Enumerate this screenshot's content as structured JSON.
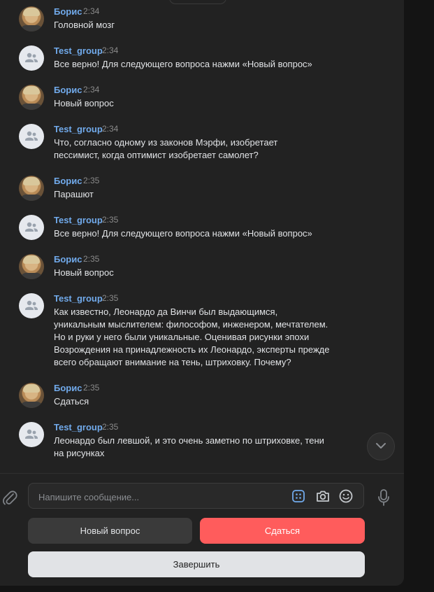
{
  "messages": [
    {
      "author": "Борис",
      "time": "2:34",
      "text": "Головной мозг",
      "avatar": "boris"
    },
    {
      "author": "Test_group",
      "time": "2:34",
      "text": "Все верно! Для следующего вопроса нажми «Новый вопрос»",
      "avatar": "group"
    },
    {
      "author": "Борис",
      "time": "2:34",
      "text": "Новый вопрос",
      "avatar": "boris"
    },
    {
      "author": "Test_group",
      "time": "2:34",
      "text": "Что, согласно одному из законов Мэрфи, изобретает\nпессимист, когда оптимист изобретает самолет?",
      "avatar": "group"
    },
    {
      "author": "Борис",
      "time": "2:35",
      "text": "Парашют",
      "avatar": "boris"
    },
    {
      "author": "Test_group",
      "time": "2:35",
      "text": "Все верно! Для следующего вопроса нажми «Новый вопрос»",
      "avatar": "group"
    },
    {
      "author": "Борис",
      "time": "2:35",
      "text": "Новый вопрос",
      "avatar": "boris"
    },
    {
      "author": "Test_group",
      "time": "2:35",
      "text": "Как известно, Леонардо да Винчи был выдающимся,\nуникальным мыслителем: философом, инженером, мечтателем.\nНо и руки у него были уникальные. Оценивая рисунки эпохи\nВозрождения на принадлежность их Леонардо, эксперты прежде\nвсего обращают внимание на тень, штриховку. Почему?",
      "avatar": "group"
    },
    {
      "author": "Борис",
      "time": "2:35",
      "text": "Сдаться",
      "avatar": "boris"
    },
    {
      "author": "Test_group",
      "time": "2:35",
      "text": "Леонардо был левшой, и это очень заметно по штриховке, тени\nна рисунках",
      "avatar": "group"
    }
  ],
  "composer": {
    "placeholder": "Напишите сообщение...",
    "icons": [
      "paperclip-icon",
      "keyboard-bot-icon",
      "camera-icon",
      "emoji-icon",
      "microphone-icon"
    ]
  },
  "keyboard": {
    "new_question": "Новый вопрос",
    "surrender": "Сдаться",
    "finish": "Завершить"
  },
  "colors": {
    "background": "#222222",
    "author_name": "#71aaeb",
    "surrender_button": "#ff5c5c",
    "finish_button": "#e1e3e6"
  }
}
